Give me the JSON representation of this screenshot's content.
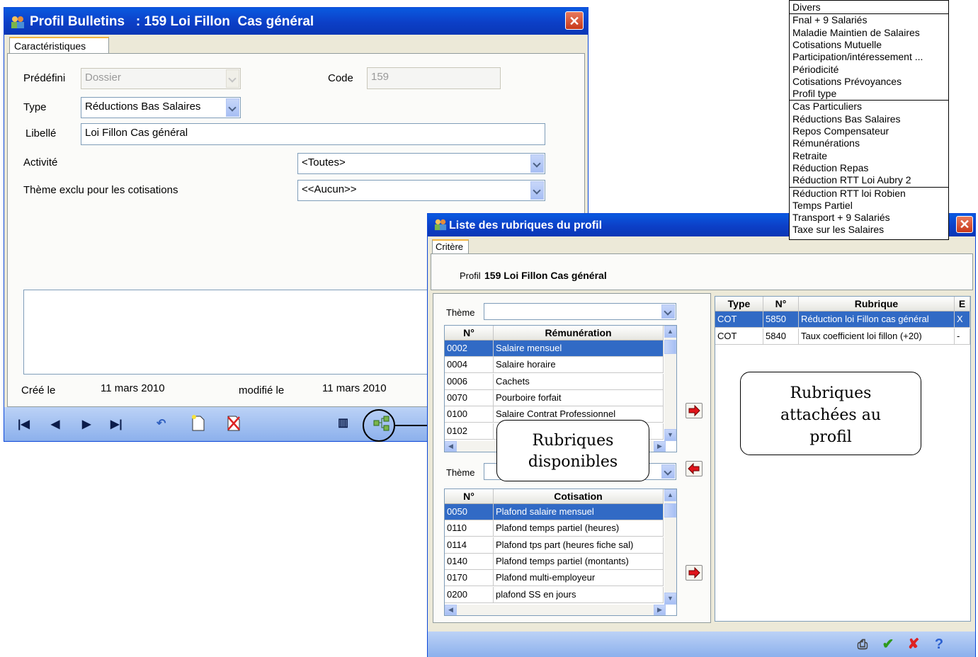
{
  "win1": {
    "title": "Profil Bulletins   : 159 Loi Fillon  Cas général",
    "tab": "Caractéristiques",
    "predefini_label": "Prédéfini",
    "predefini_value": "Dossier",
    "code_label": "Code",
    "code_value": "159",
    "type_label": "Type",
    "type_value": "Réductions Bas Salaires",
    "libelle_label": "Libellé",
    "libelle_value": "Loi Fillon  Cas général",
    "activite_label": "Activité",
    "activite_value": "<Toutes>",
    "theme_exclu_label": "Thème exclu pour les cotisations",
    "theme_exclu_value": "<<Aucun>>",
    "cree_label": "Créé le",
    "cree_value": "11 mars 2010",
    "modifie_label": "modifié le",
    "modifie_value": "11 mars 2010"
  },
  "menu": {
    "group1": [
      "Divers"
    ],
    "group2": [
      "Fnal + 9 Salariés",
      "Maladie Maintien de Salaires",
      "Cotisations Mutuelle",
      "Participation/intéressement ...",
      "Périodicité",
      "Cotisations Prévoyances",
      "Profil type"
    ],
    "group3": [
      "Cas Particuliers",
      "Réductions Bas Salaires",
      "Repos Compensateur",
      "Rémunérations",
      "Retraite",
      "Réduction Repas",
      "Réduction RTT Loi Aubry 2"
    ],
    "group4": [
      "Réduction RTT loi Robien",
      "Temps Partiel",
      "Transport + 9 Salariés",
      "Taxe sur les Salaires"
    ]
  },
  "win2": {
    "title": "Liste des rubriques du profil",
    "tab": "Critère",
    "profil_label": "Profil",
    "profil_value": "159 Loi Fillon  Cas général",
    "theme_label": "Thème",
    "theme2_label": "Thème",
    "rem_headers": {
      "num": "N°",
      "name": "Rémunération"
    },
    "rem_rows": [
      [
        "0002",
        "Salaire mensuel"
      ],
      [
        "0004",
        "Salaire horaire"
      ],
      [
        "0006",
        "Cachets"
      ],
      [
        "0070",
        "Pourboire forfait"
      ],
      [
        "0100",
        "Salaire Contrat Professionnel"
      ],
      [
        "0102",
        "S"
      ]
    ],
    "cot_headers": {
      "num": "N°",
      "name": "Cotisation"
    },
    "cot_rows": [
      [
        "0050",
        "Plafond salaire mensuel"
      ],
      [
        "0110",
        "Plafond temps partiel (heures)"
      ],
      [
        "0114",
        "Plafond tps part (heures fiche sal)"
      ],
      [
        "0140",
        "Plafond temps partiel (montants)"
      ],
      [
        "0170",
        "Plafond multi-employeur"
      ],
      [
        "0200",
        "plafond SS en jours"
      ]
    ],
    "right_headers": {
      "type": "Type",
      "num": "N°",
      "rubrique": "Rubrique",
      "e": "E"
    },
    "right_rows": [
      [
        "COT",
        "5850",
        "Réduction loi Fillon cas général",
        "X"
      ],
      [
        "COT",
        "5840",
        "Taux coefficient loi fillon (+20)",
        "-"
      ]
    ]
  },
  "callouts": {
    "disponibles_line1": "Rubriques",
    "disponibles_line2": "disponibles",
    "attachees_line1": "Rubriques",
    "attachees_line2": "attachées au",
    "attachees_line3": "profil"
  }
}
